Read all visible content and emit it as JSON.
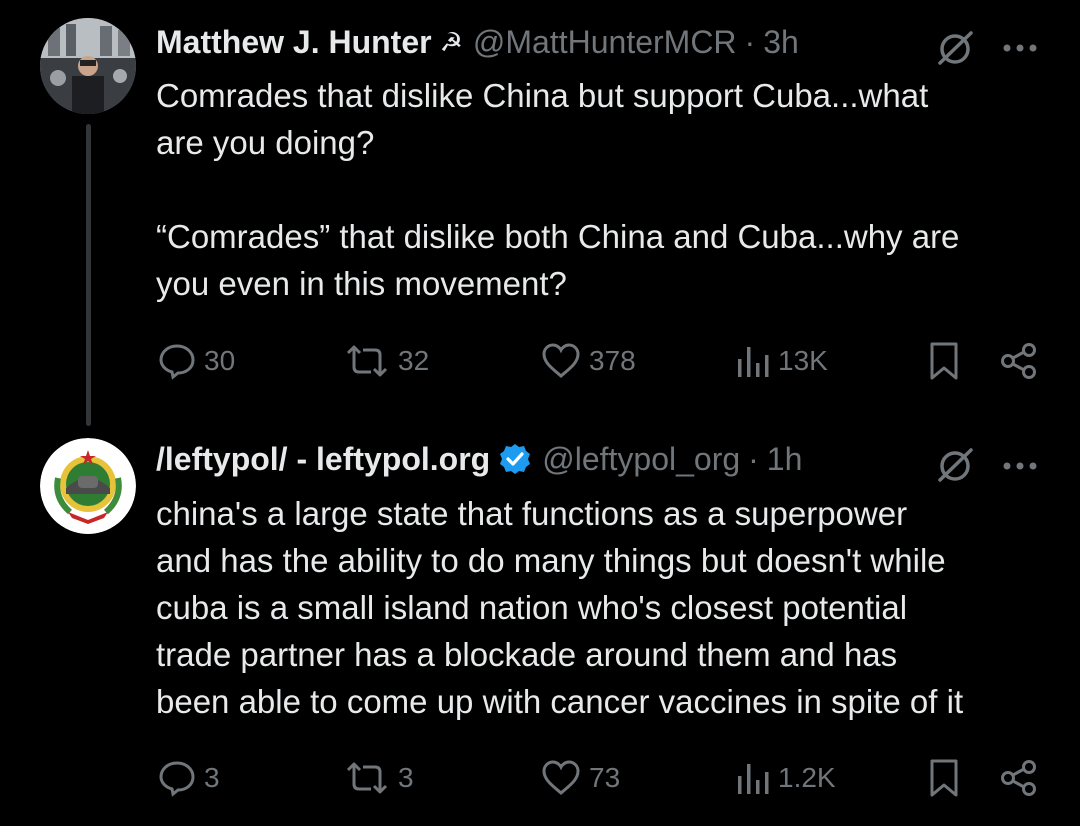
{
  "tweets": [
    {
      "display_name": "Matthew J. Hunter",
      "name_emoji": "☭",
      "handle": "@MattHunterMCR",
      "separator": "·",
      "time": "3h",
      "text": "Comrades that dislike China but support Cuba...what\nare you doing?\n\n“Comrades” that dislike both China and Cuba...why are\nyou even in this movement?",
      "replies": "30",
      "reposts": "32",
      "likes": "378",
      "views": "13K"
    },
    {
      "display_name": "/leftypol/ - leftypol.org",
      "handle": "@leftypol_org",
      "separator": "·",
      "time": "1h",
      "verified": true,
      "text": "china's a large state that functions as a superpower\nand has the ability to do many things but doesn't while\ncuba is a small island nation who's closest potential\ntrade partner has a blockade around them and has\nbeen able to come up with cancer vaccines in spite of it",
      "replies": "3",
      "reposts": "3",
      "likes": "73",
      "views": "1.2K"
    }
  ],
  "icons": {
    "reply": "reply-icon",
    "repost": "repost-icon",
    "like": "like-icon",
    "views": "views-icon",
    "bookmark": "bookmark-icon",
    "share": "share-icon",
    "grok": "grok-icon",
    "more": "more-icon",
    "verified": "verified-badge-icon"
  },
  "colors": {
    "background": "#000000",
    "text": "#e7e9ea",
    "secondary": "#71767b",
    "verified": "#1d9bf0"
  }
}
